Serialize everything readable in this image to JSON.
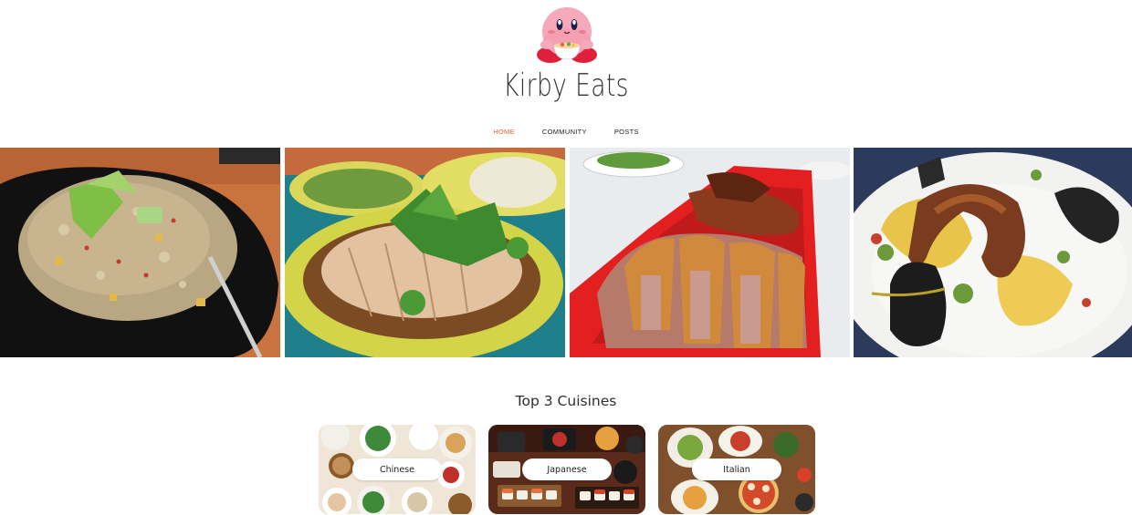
{
  "brand": {
    "name": "Kirby Eats",
    "logo_icon": "kirby-eating-icon"
  },
  "nav": {
    "items": [
      {
        "label": "HOME",
        "active": true
      },
      {
        "label": "COMMUNITY",
        "active": false
      },
      {
        "label": "POSTS",
        "active": false
      }
    ]
  },
  "gallery": {
    "photos": [
      {
        "subject": "fried rice on black plate"
      },
      {
        "subject": "hainanese chicken rice"
      },
      {
        "subject": "roast duck on red tray"
      },
      {
        "subject": "grilled octopus with olive oil"
      }
    ]
  },
  "cuisines": {
    "title": "Top 3 Cuisines",
    "items": [
      {
        "label": "Chinese"
      },
      {
        "label": "Japanese"
      },
      {
        "label": "Italian"
      }
    ]
  },
  "colors": {
    "nav_active": "#e8663d",
    "text": "#2f3438",
    "kirby_pink": "#f3a5b6"
  }
}
